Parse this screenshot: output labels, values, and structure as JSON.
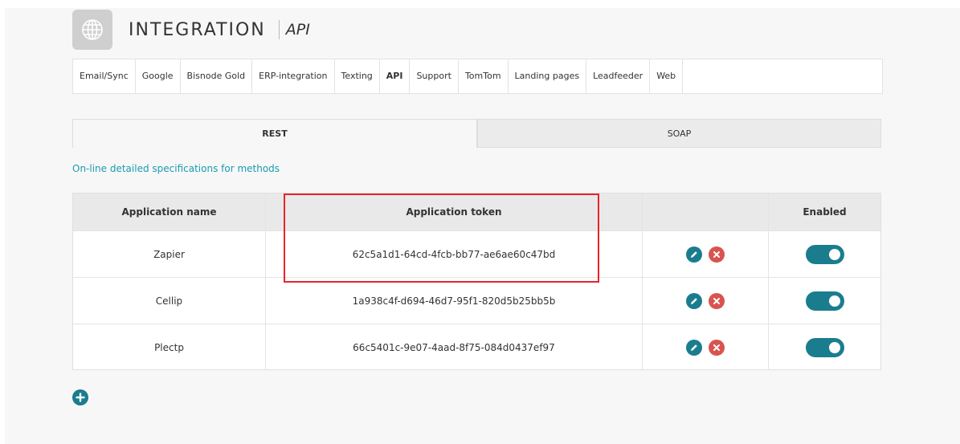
{
  "header": {
    "title": "INTEGRATION",
    "subtitle": "API",
    "icon": "globe-icon"
  },
  "tabs": [
    {
      "label": "Email/Sync"
    },
    {
      "label": "Google"
    },
    {
      "label": "Bisnode Gold"
    },
    {
      "label": "ERP-integration"
    },
    {
      "label": "Texting"
    },
    {
      "label": "API",
      "active": true
    },
    {
      "label": "Support"
    },
    {
      "label": "TomTom"
    },
    {
      "label": "Landing pages"
    },
    {
      "label": "Leadfeeder"
    },
    {
      "label": "Web"
    }
  ],
  "subtabs": {
    "rest": "REST",
    "soap": "SOAP",
    "active": "REST"
  },
  "spec_link": "On-line detailed specifications for methods",
  "table": {
    "headers": {
      "name": "Application name",
      "token": "Application token",
      "actions": "",
      "enabled": "Enabled"
    },
    "rows": [
      {
        "name": "Zapier",
        "token": "62c5a1d1-64cd-4fcb-bb77-ae6ae60c47bd",
        "enabled": true
      },
      {
        "name": "Cellip",
        "token": "1a938c4f-d694-46d7-95f1-820d5b25bb5b",
        "enabled": true
      },
      {
        "name": "Plectp",
        "token": "66c5401c-9e07-4aad-8f75-084d0437ef97",
        "enabled": true
      }
    ]
  },
  "colors": {
    "accent": "#1a7d8e",
    "link": "#1a9bb0",
    "delete": "#d9534f",
    "highlight": "#e8232b"
  }
}
